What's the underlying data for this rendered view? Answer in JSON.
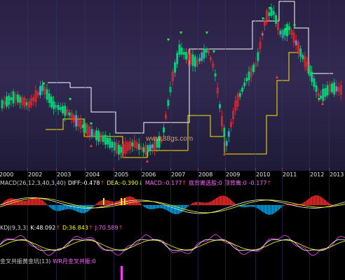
{
  "years": [
    "2000",
    "2002",
    "2003",
    "2004",
    "2005",
    "2006",
    "2007",
    "2008",
    "2009",
    "2010",
    "2011",
    "2012",
    "2013"
  ],
  "watermark": "www.88gs.com",
  "macd": {
    "title": "MACD(26,12,3,40,3,40)",
    "diff_label": "DIFF:",
    "diff_value": "-0.478",
    "diff_arrow": "↑",
    "dea_label": "DEA:",
    "dea_value": "-0.390",
    "dea_arrow": "↓",
    "macd_label": "MACD:",
    "macd_value": "-0.177",
    "macd_arrow": "↑",
    "sig1": "底背离选股:0",
    "sig2": "顶背离:0",
    "sig2_value": "-0.177",
    "sig2_arrow": "↑"
  },
  "kdj": {
    "title": "KDJ(9,3,3)",
    "k_label": "K:",
    "k_value": "48.092",
    "k_arrow": "↑",
    "d_label": "D:",
    "d_value": "36.843",
    "d_arrow": "↑",
    "j_label": "J:",
    "j_value": "70.589",
    "j_arrow": "↑"
  },
  "ind3": {
    "title": "金叉共振黄金坑(13)",
    "label2": "WR月金叉共振:",
    "value2": "0"
  },
  "colors": {
    "up": "#ff2a2a",
    "down": "#00d27a",
    "accent": "#ffff00",
    "diff": "#ffffff",
    "dea": "#ffff00",
    "macd_bar_pos": "#ff4040",
    "macd_bar_neg": "#00c8ff",
    "kdj_k": "#ffffff",
    "kdj_d": "#ffff00",
    "kdj_j": "#ff3cff",
    "stop_white": "#ffffff",
    "stop_yellow": "#ffe600",
    "ind3_bar": "#ff39ff"
  }
}
